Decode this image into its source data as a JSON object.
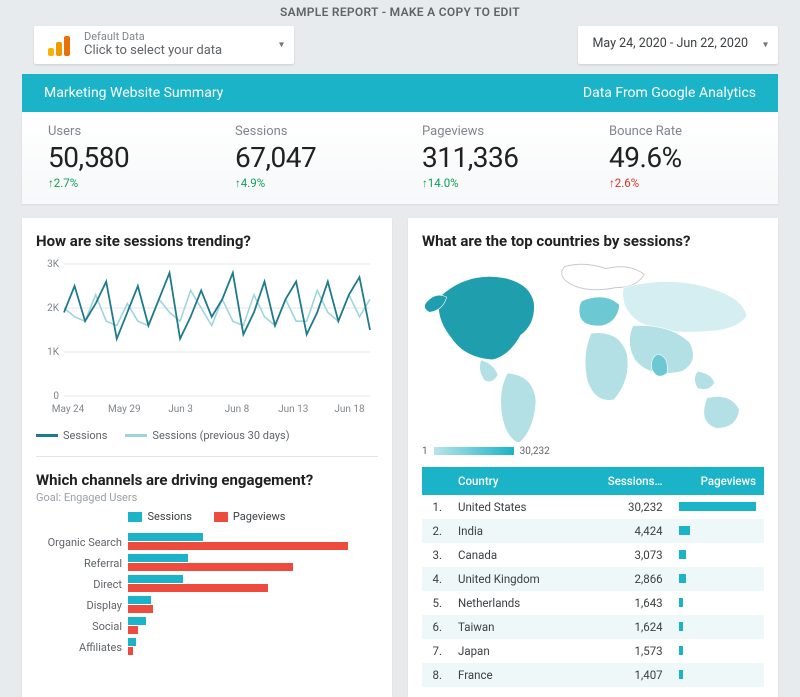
{
  "header_note": "SAMPLE REPORT - MAKE A COPY TO EDIT",
  "datasource": {
    "small": "Default Data",
    "large": "Click to select your data"
  },
  "daterange": "May 24, 2020 - Jun 22, 2020",
  "titlebar": {
    "left": "Marketing Website Summary",
    "right": "Data From Google Analytics"
  },
  "kpis": [
    {
      "label": "Users",
      "value": "50,580",
      "delta": "2.7%",
      "dir": "up"
    },
    {
      "label": "Sessions",
      "value": "67,047",
      "delta": "4.9%",
      "dir": "up"
    },
    {
      "label": "Pageviews",
      "value": "311,336",
      "delta": "14.0%",
      "dir": "up"
    },
    {
      "label": "Bounce Rate",
      "value": "49.6%",
      "delta": "2.6%",
      "dir": "down"
    }
  ],
  "trend": {
    "title": "How are site sessions trending?",
    "yticks": [
      "0",
      "1K",
      "2K",
      "3K"
    ],
    "xticks": [
      "May 24",
      "May 29",
      "Jun 3",
      "Jun 8",
      "Jun 13",
      "Jun 18"
    ],
    "legend": [
      "Sessions",
      "Sessions (previous 30 days)"
    ],
    "colors": {
      "current": "#1f7a8c",
      "previous": "#9ed5dc"
    }
  },
  "map": {
    "title": "What are the top countries by sessions?",
    "legend_min": "1",
    "legend_max": "30,232"
  },
  "countries": {
    "headers": [
      "",
      "Country",
      "Sessions…",
      "Pageviews"
    ],
    "rows": [
      {
        "n": "1.",
        "name": "United States",
        "sessions": "30,232",
        "pv": 100
      },
      {
        "n": "2.",
        "name": "India",
        "sessions": "4,424",
        "pv": 15
      },
      {
        "n": "3.",
        "name": "Canada",
        "sessions": "3,073",
        "pv": 10
      },
      {
        "n": "4.",
        "name": "United Kingdom",
        "sessions": "2,866",
        "pv": 9
      },
      {
        "n": "5.",
        "name": "Netherlands",
        "sessions": "1,643",
        "pv": 6
      },
      {
        "n": "6.",
        "name": "Taiwan",
        "sessions": "1,624",
        "pv": 6
      },
      {
        "n": "7.",
        "name": "Japan",
        "sessions": "1,573",
        "pv": 5
      },
      {
        "n": "8.",
        "name": "France",
        "sessions": "1,407",
        "pv": 5
      }
    ]
  },
  "channels": {
    "title": "Which channels are driving engagement?",
    "subtitle": "Goal: Engaged Users",
    "legend": [
      "Sessions",
      "Pageviews"
    ],
    "colors": {
      "sessions": "#1bb3c7",
      "pageviews": "#ed4b3e"
    },
    "rows": [
      {
        "name": "Organic Search",
        "sessions": 30,
        "pageviews": 88
      },
      {
        "name": "Referral",
        "sessions": 24,
        "pageviews": 66
      },
      {
        "name": "Direct",
        "sessions": 22,
        "pageviews": 56
      },
      {
        "name": "Display",
        "sessions": 9,
        "pageviews": 10
      },
      {
        "name": "Social",
        "sessions": 7,
        "pageviews": 4
      },
      {
        "name": "Affiliates",
        "sessions": 3,
        "pageviews": 2
      }
    ]
  },
  "chart_data": [
    {
      "type": "line",
      "title": "How are site sessions trending?",
      "xticks": [
        "May 24",
        "May 29",
        "Jun 3",
        "Jun 8",
        "Jun 13",
        "Jun 18"
      ],
      "ylim": [
        0,
        3000
      ],
      "series": [
        {
          "name": "Sessions",
          "values": [
            1900,
            2500,
            1700,
            2100,
            2600,
            1300,
            1900,
            2500,
            1600,
            2200,
            2800,
            1300,
            1800,
            2400,
            1800,
            2200,
            2800,
            1400,
            1900,
            2600,
            1600,
            2200,
            2600,
            1400,
            1900,
            2600,
            1700,
            2300,
            2700,
            1500
          ]
        },
        {
          "name": "Sessions (previous 30 days)",
          "values": [
            2000,
            1800,
            1700,
            2300,
            1700,
            1600,
            2100,
            1700,
            1600,
            2200,
            1900,
            1700,
            2400,
            2000,
            1600,
            2200,
            1700,
            1600,
            2300,
            1800,
            1600,
            2200,
            1700,
            1700,
            2400,
            1900,
            1700,
            2300,
            1800,
            2200
          ]
        }
      ]
    },
    {
      "type": "bar",
      "title": "Which channels are driving engagement?",
      "categories": [
        "Organic Search",
        "Referral",
        "Direct",
        "Display",
        "Social",
        "Affiliates"
      ],
      "series": [
        {
          "name": "Sessions",
          "values": [
            30,
            24,
            22,
            9,
            7,
            3
          ]
        },
        {
          "name": "Pageviews",
          "values": [
            88,
            66,
            56,
            10,
            4,
            2
          ]
        }
      ]
    },
    {
      "type": "table",
      "title": "What are the top countries by sessions?",
      "columns": [
        "Country",
        "Sessions",
        "Pageviews(rel%)"
      ],
      "rows": [
        [
          "United States",
          30232,
          100
        ],
        [
          "India",
          4424,
          15
        ],
        [
          "Canada",
          3073,
          10
        ],
        [
          "United Kingdom",
          2866,
          9
        ],
        [
          "Netherlands",
          1643,
          6
        ],
        [
          "Taiwan",
          1624,
          6
        ],
        [
          "Japan",
          1573,
          5
        ],
        [
          "France",
          1407,
          5
        ]
      ]
    }
  ]
}
